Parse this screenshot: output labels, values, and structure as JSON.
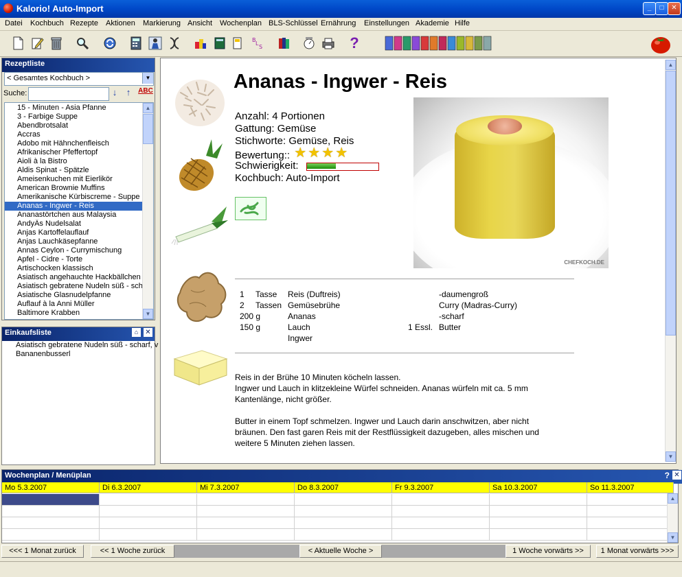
{
  "window": {
    "title": "Kalorio!   Auto-Import",
    "minimize": "_",
    "maximize": "□",
    "close": "✕"
  },
  "menu": [
    "Datei",
    "Kochbuch",
    "Rezepte",
    "Aktionen",
    "Markierung",
    "Ansicht",
    "Wochenplan",
    "BLS-Schlüssel",
    "Ernährung",
    "Einstellungen",
    "Akademie",
    "Hilfe"
  ],
  "toolbar_icons": [
    "new-document-icon",
    "edit-icon",
    "trash-icon",
    "search-icon",
    "refresh-icon",
    "calculator-icon",
    "scale-person-icon",
    "dna-icon",
    "color-sort-icon",
    "book-icon",
    "bls-icon",
    "books-icon",
    "kitchen-scale-icon",
    "print-icon",
    "help-icon",
    "color-cans-icon",
    "tomato-logo-icon"
  ],
  "toolbar_help_glyph": "?",
  "rezeptliste": {
    "title": "Rezeptliste",
    "cookbook_select": "< Gesamtes Kochbuch >",
    "search_label": "Suche:",
    "search_value": "",
    "abc_label": "ABC",
    "down_label": "↓",
    "up_label": "↑",
    "selected_index": 11,
    "items": [
      "15 - Minuten - Asia Pfanne",
      "3 - Farbige Suppe",
      "Abendbrotsalat",
      "Accras",
      "Adobo mit Hähnchenfleisch",
      "Afrikanischer Pfeffertopf",
      "Aioli à la Bistro",
      "Aldis Spinat - Spätzle",
      "Ameisenkuchen mit Eierlikör",
      "American Brownie Muffins",
      "Amerikanische Kürbiscreme - Suppe",
      "Ananas - Ingwer - Reis",
      "Ananastörtchen aus Malaysia",
      "AndyÄs Nudelsalat",
      "Anjas Kartoffelauflauf",
      "Anjas Lauchkäsepfanne",
      "Annas Ceylon - Currymischung",
      "Apfel - Cidre - Torte",
      "Artischocken klassisch",
      "Asiatisch angehauchte Hackbällchen",
      "Asiatisch gebratene Nudeln süß - scha",
      "Asiatische Glasnudelpfanne",
      "Auflauf à la Anni Müller",
      "Baltimore Krabben"
    ]
  },
  "einkaufsliste": {
    "title": "Einkaufsliste",
    "items": [
      "Asiatisch gebratene Nudeln süß - scharf, v",
      "Bananenbusserl"
    ]
  },
  "recipe": {
    "title": "Ananas - Ingwer - Reis",
    "anzahl": "Anzahl: 4 Portionen",
    "gattung": "Gattung: Gemüse",
    "stichworte": "Stichworte: Gemüse, Reis",
    "bewertung_label": "Bewertung::",
    "rating": 4,
    "schwierigkeit_label": "Schwierigkeit:",
    "difficulty": 0.4,
    "kochbuch": "Kochbuch: Auto-Import",
    "photo_watermark": "CHEFKOCH.DE",
    "ingredients_left": [
      {
        "qty": "1",
        "unit": "Tasse",
        "name": "Reis (Duftreis)"
      },
      {
        "qty": "2",
        "unit": "Tassen",
        "name": "Gemüsebrühe"
      },
      {
        "qty": "200 g",
        "unit": "",
        "name": "Ananas"
      },
      {
        "qty": "150 g",
        "unit": "",
        "name": "Lauch"
      },
      {
        "qty": "",
        "unit": "",
        "name": "Ingwer"
      }
    ],
    "ingredients_right": [
      {
        "qty": "",
        "name": "-daumengroß"
      },
      {
        "qty": "",
        "name": "Curry (Madras-Curry)"
      },
      {
        "qty": "",
        "name": "-scharf"
      },
      {
        "qty": "1 Essl.",
        "name": "Butter"
      }
    ],
    "preparation": [
      "Reis in der Brühe 10 Minuten köcheln lassen.",
      "Ingwer und Lauch in klitzekleine Würfel schneiden. Ananas würfeln mit ca. 5 mm",
      "Kantenlänge, nicht größer.",
      "",
      "Butter in einem Topf schmelzen. Ingwer und Lauch darin anschwitzen, aber nicht",
      "bräunen. Den fast garen Reis mit der Restflüssigkeit dazugeben, alles mischen und",
      "weitere 5 Minuten ziehen lassen."
    ]
  },
  "wochenplan": {
    "title": "Wochenplan / Menüplan",
    "help": "?",
    "close": "✕",
    "days": [
      "Mo 5.3.2007",
      "Di 6.3.2007",
      "Mi 7.3.2007",
      "Do 8.3.2007",
      "Fr 9.3.2007",
      "Sa 10.3.2007",
      "So 11.3.2007"
    ],
    "nav": {
      "month_back": "<<< 1 Monat zurück",
      "week_back": "<< 1 Woche zurück",
      "current": "< Aktuelle Woche >",
      "week_forward": "1 Woche vorwärts >>",
      "month_forward": "1 Monat vorwärts >>>"
    }
  },
  "colors": {
    "selection": "#316ac5",
    "panel_header": "#0a246a",
    "day_header": "#ffff00",
    "stars": "#f2c200"
  }
}
